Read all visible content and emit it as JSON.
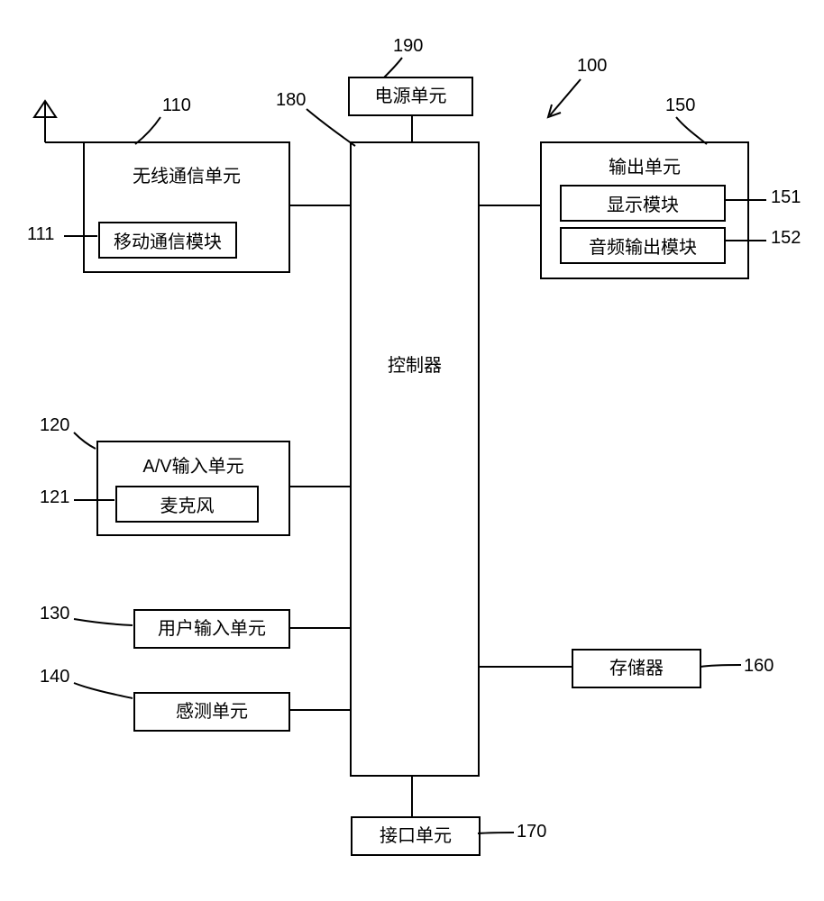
{
  "blocks": {
    "power": {
      "label": "电源单元",
      "ref": "190"
    },
    "device": {
      "ref": "100"
    },
    "wireless": {
      "label": "无线通信单元",
      "ref": "110"
    },
    "mobile_comm": {
      "label": "移动通信模块",
      "ref": "111"
    },
    "controller": {
      "label": "控制器",
      "ref": "180"
    },
    "output": {
      "label": "输出单元",
      "ref": "150"
    },
    "display_mod": {
      "label": "显示模块",
      "ref": "151"
    },
    "audio_out": {
      "label": "音频输出模块",
      "ref": "152"
    },
    "av_input": {
      "label": "A/V输入单元",
      "ref": "120"
    },
    "microphone": {
      "label": "麦克风",
      "ref": "121"
    },
    "user_input": {
      "label": "用户输入单元",
      "ref": "130"
    },
    "sensing": {
      "label": "感测单元",
      "ref": "140"
    },
    "memory": {
      "label": "存储器",
      "ref": "160"
    },
    "interface": {
      "label": "接口单元",
      "ref": "170"
    }
  }
}
